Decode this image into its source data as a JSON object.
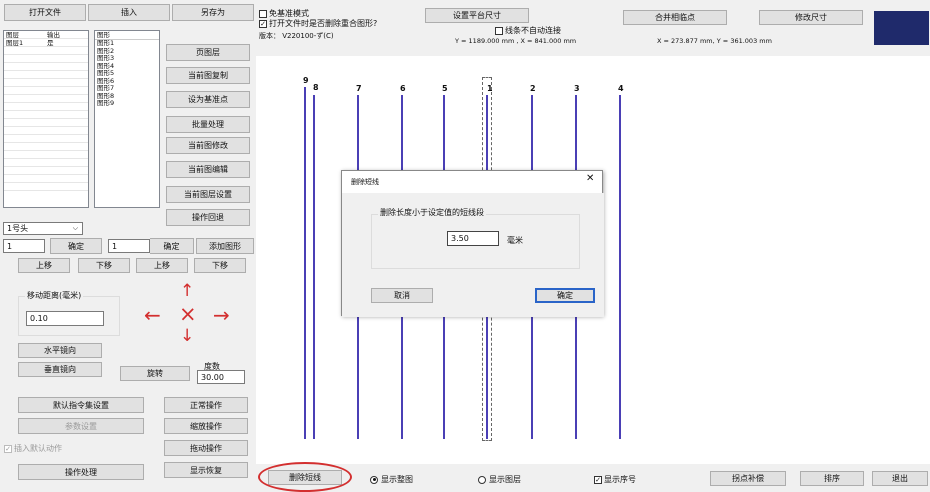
{
  "toolbar_left": {
    "open_file": "打开文件",
    "insert": "插入",
    "save_as": "另存为"
  },
  "layers": {
    "headers": [
      "图层",
      "输出"
    ],
    "rows": [
      {
        "name": "图层1",
        "output": "是"
      }
    ]
  },
  "figure_list": {
    "header": "图形",
    "items": [
      "图形1",
      "图形2",
      "图形3",
      "图形4",
      "图形5",
      "图形6",
      "图形7",
      "图形8",
      "图形9"
    ]
  },
  "side_buttons": [
    "页图层",
    "当前图复制",
    "设为基准点",
    "批量处理",
    "当前图修改",
    "当前图编辑",
    "当前图层设置",
    "操作回退"
  ],
  "head_select": "1号头",
  "row_inputs": {
    "input1": "1",
    "confirm1": "确定",
    "input2": "1",
    "confirm2": "确定",
    "add_figure": "添加图形"
  },
  "move_buttons": {
    "up1": "上移",
    "down1": "下移",
    "up2": "上移",
    "down2": "下移"
  },
  "move": {
    "label": "移动距离(毫米)",
    "value": "0.10"
  },
  "arrows": {
    "up": "↑",
    "down": "↓",
    "left": "←",
    "right": "→",
    "center": "×"
  },
  "flip": {
    "horizontal": "水平镜向",
    "vertical": "垂直镜向",
    "rotate": "旋转",
    "degree_label": "度数",
    "degree_value": "30.00"
  },
  "bottom_left": {
    "default_cmd": "默认指令集设置",
    "params": "参数设置",
    "insert_default": "插入默认动作",
    "op_process": "操作处理",
    "normal": "正常操作",
    "scale": "缩放操作",
    "drag": "拖动操作",
    "display_restore": "显示恢复"
  },
  "top": {
    "base_mode": "免基准模式",
    "delete_overlap": "打开文件时是否删除重合图形?",
    "version": "版本： V220100-ず(C)",
    "set_platform": "设置平台尺寸",
    "line_no_connect": "线条不自动连接",
    "size_readout": "Y = 1189.000 mm , X = 841.000 mm",
    "merge_points": "合并相临点",
    "modify_size": "修改尺寸",
    "coord_readout": "X = 273.877 mm, Y = 361.003 mm"
  },
  "canvas": {
    "labels": [
      "9",
      "8",
      "7",
      "6",
      "5",
      "1",
      "2",
      "3",
      "4"
    ],
    "line_color": "#4a3fb5"
  },
  "dialog": {
    "title": "删除短线",
    "close": "✕",
    "group_label": "删除长度小于设定值的短线段",
    "value": "3.50",
    "unit": "毫米",
    "cancel": "取消",
    "ok": "确定"
  },
  "bottom_bar": {
    "delete_short": "删除短线",
    "show_whole": "显示整图",
    "show_layer": "显示图层",
    "show_seq": "显示序号",
    "break_fix": "拐点补偿",
    "sort": "排序",
    "exit": "退出"
  },
  "colors": {
    "accent": "#1f2a6b",
    "highlight": "#d32f2f",
    "line": "#4a3fb5"
  }
}
